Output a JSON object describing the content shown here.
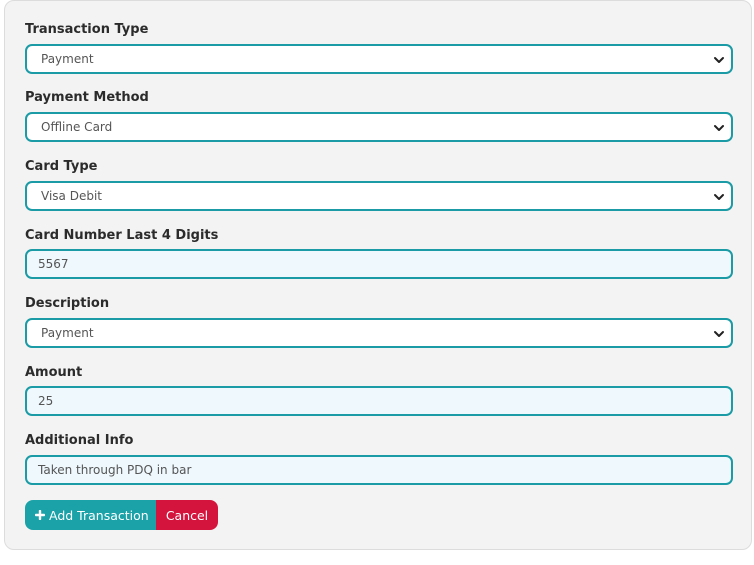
{
  "form": {
    "transaction_type": {
      "label": "Transaction Type",
      "value": "Payment"
    },
    "payment_method": {
      "label": "Payment Method",
      "value": "Offline Card"
    },
    "card_type": {
      "label": "Card Type",
      "value": "Visa Debit"
    },
    "card_last4": {
      "label": "Card Number Last 4 Digits",
      "value": "5567"
    },
    "description": {
      "label": "Description",
      "value": "Payment"
    },
    "amount": {
      "label": "Amount",
      "value": "25"
    },
    "additional_info": {
      "label": "Additional Info",
      "value": "Taken through PDQ in bar"
    }
  },
  "actions": {
    "add_label": "Add Transaction",
    "cancel_label": "Cancel"
  },
  "icons": {
    "add": "plus-icon",
    "select": "chevron-down-icon"
  },
  "colors": {
    "accent": "#1a9ba5",
    "add_button": "#1aa2a8",
    "cancel_button": "#d5143e",
    "panel": "#f3f3f3"
  }
}
